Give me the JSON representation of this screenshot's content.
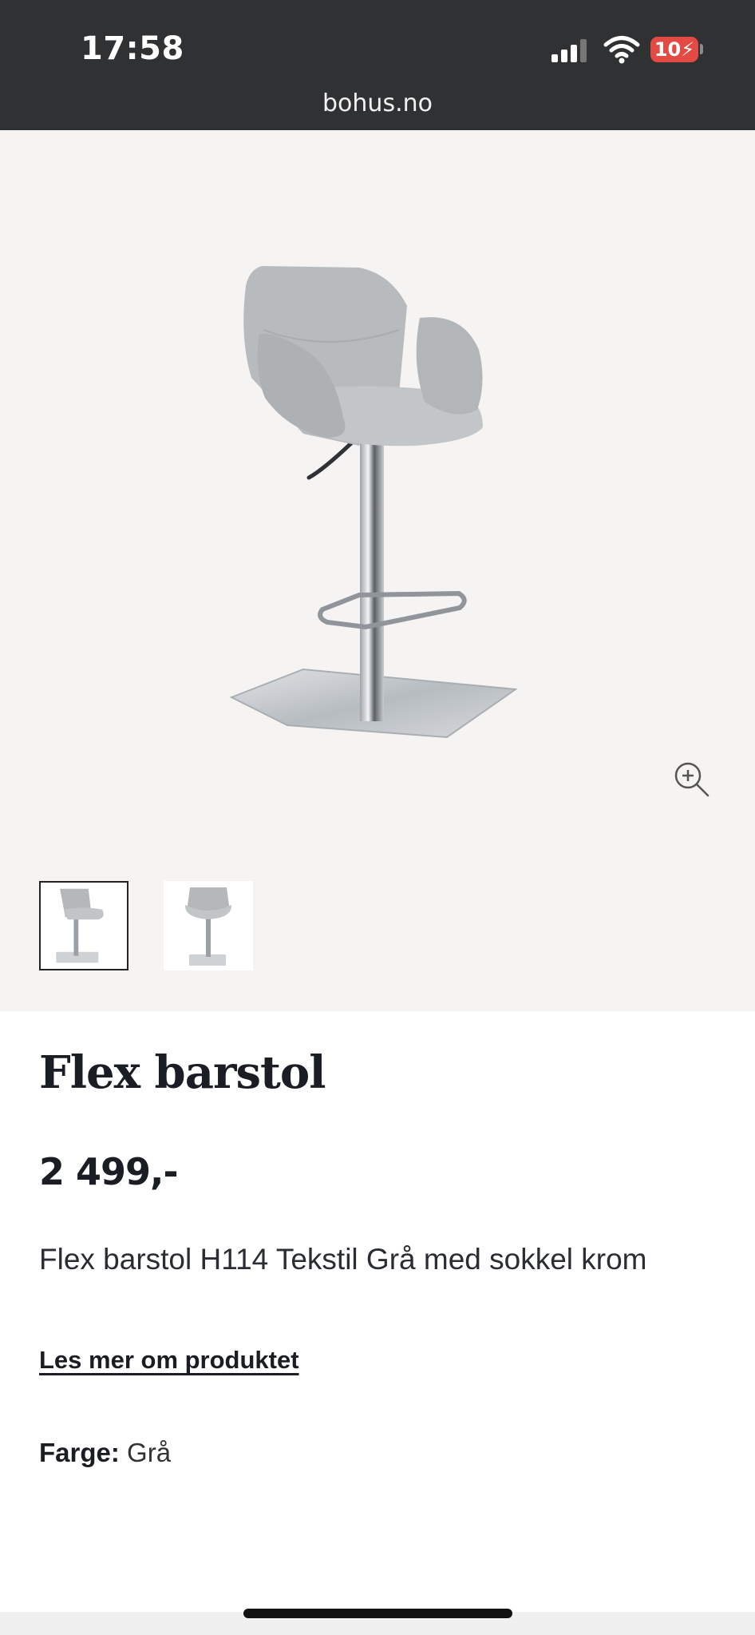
{
  "status_bar": {
    "time": "17:58",
    "battery_level": "10",
    "url": "bohus.no"
  },
  "product": {
    "name": "Flex barstol",
    "price": "2 499,-",
    "description": "Flex barstol H114 Tekstil Grå med sokkel krom",
    "read_more_label": "Les mer om produktet",
    "color_label": "Farge:",
    "color_value": "Grå"
  },
  "gallery": {
    "thumbnail_count": 2,
    "selected_index": 0
  },
  "colors": {
    "status_bar_bg": "#2f3133",
    "gallery_bg": "#f5f4f2",
    "battery_low": "#e24a43",
    "text_dark": "#1a1d24"
  },
  "icons": [
    "signal-icon",
    "wifi-icon",
    "battery-icon",
    "zoom-icon"
  ]
}
